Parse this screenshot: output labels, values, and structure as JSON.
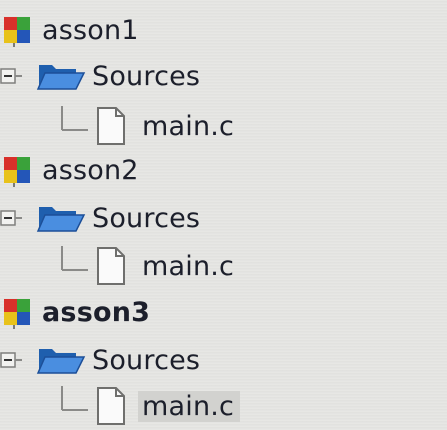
{
  "tree": {
    "projects": [
      {
        "name": "asson1",
        "bold": false,
        "folder": "Sources",
        "file": "main.c",
        "file_selected": false
      },
      {
        "name": "asson2",
        "bold": false,
        "folder": "Sources",
        "file": "main.c",
        "file_selected": false
      },
      {
        "name": "asson3",
        "bold": true,
        "folder": "Sources",
        "file": "main.c",
        "file_selected": true
      }
    ]
  },
  "icons": {
    "project": "workspace-project-icon",
    "expander": "collapse-minus-icon",
    "folder": "open-folder-icon",
    "file": "source-file-icon"
  },
  "colors": {
    "background": "#e6e6e3",
    "text": "#1c1f2b",
    "folder_blue": "#2f6fc0",
    "project_red": "#d8302a",
    "project_green": "#3aa23a",
    "project_blue": "#2456b8",
    "project_yellow": "#e8c21a",
    "selection": "#d2d2cf"
  }
}
